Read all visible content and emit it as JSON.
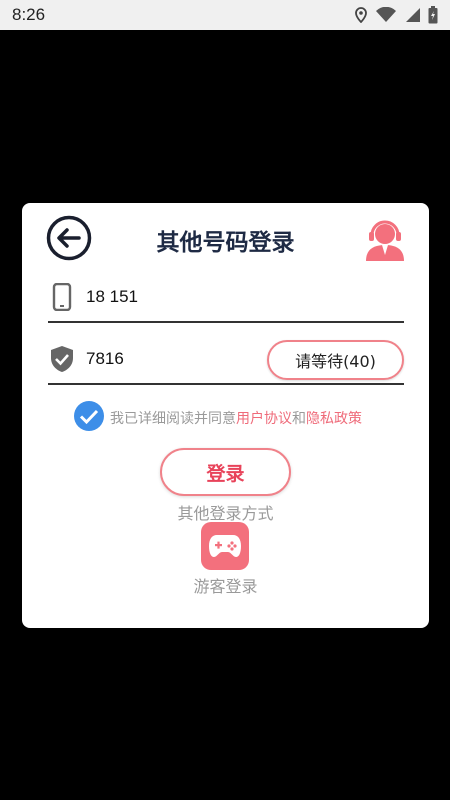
{
  "status_bar": {
    "time": "8:26",
    "icons": [
      "location-icon",
      "wifi-icon",
      "signal-icon",
      "battery-icon"
    ]
  },
  "dialog": {
    "title": "其他号码登录",
    "back_icon": "back-arrow-icon",
    "service_icon": "customer-service-icon",
    "phone": {
      "icon": "phone-icon",
      "value": "18   151"
    },
    "code": {
      "icon": "shield-check-icon",
      "value": "7816",
      "wait_button_label": "请等待(40)"
    },
    "agreement": {
      "checked": true,
      "text": "我已详细阅读并同意",
      "user_agreement": "用户协议",
      "and": "和",
      "privacy_policy": "隐私政策"
    },
    "login_button_label": "登录",
    "other_login_label": "其他登录方式",
    "guest_login_label": "游客登录",
    "guest_icon": "gamepad-icon"
  },
  "colors": {
    "accent": "#f3707d",
    "link": "#ef6b7a",
    "login_text": "#e8435a",
    "title": "#1e2a44",
    "check_blue": "#3d8ee8"
  }
}
